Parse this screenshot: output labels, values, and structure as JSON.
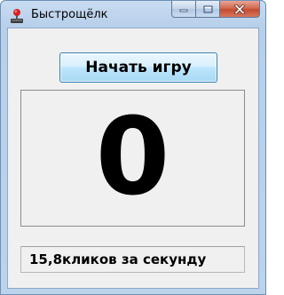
{
  "window": {
    "title": "Быстрощёлк",
    "icon": "joystick-icon",
    "controls": {
      "minimize": "minimize-icon",
      "maximize": "maximize-icon",
      "close": "close-icon"
    }
  },
  "main": {
    "start_button_label": "Начать игру",
    "counter_value": "0",
    "rate_text": "15,8кликов за секунду"
  },
  "colors": {
    "close_button": "#c24c2f",
    "start_button_border": "#3c7fb1"
  }
}
